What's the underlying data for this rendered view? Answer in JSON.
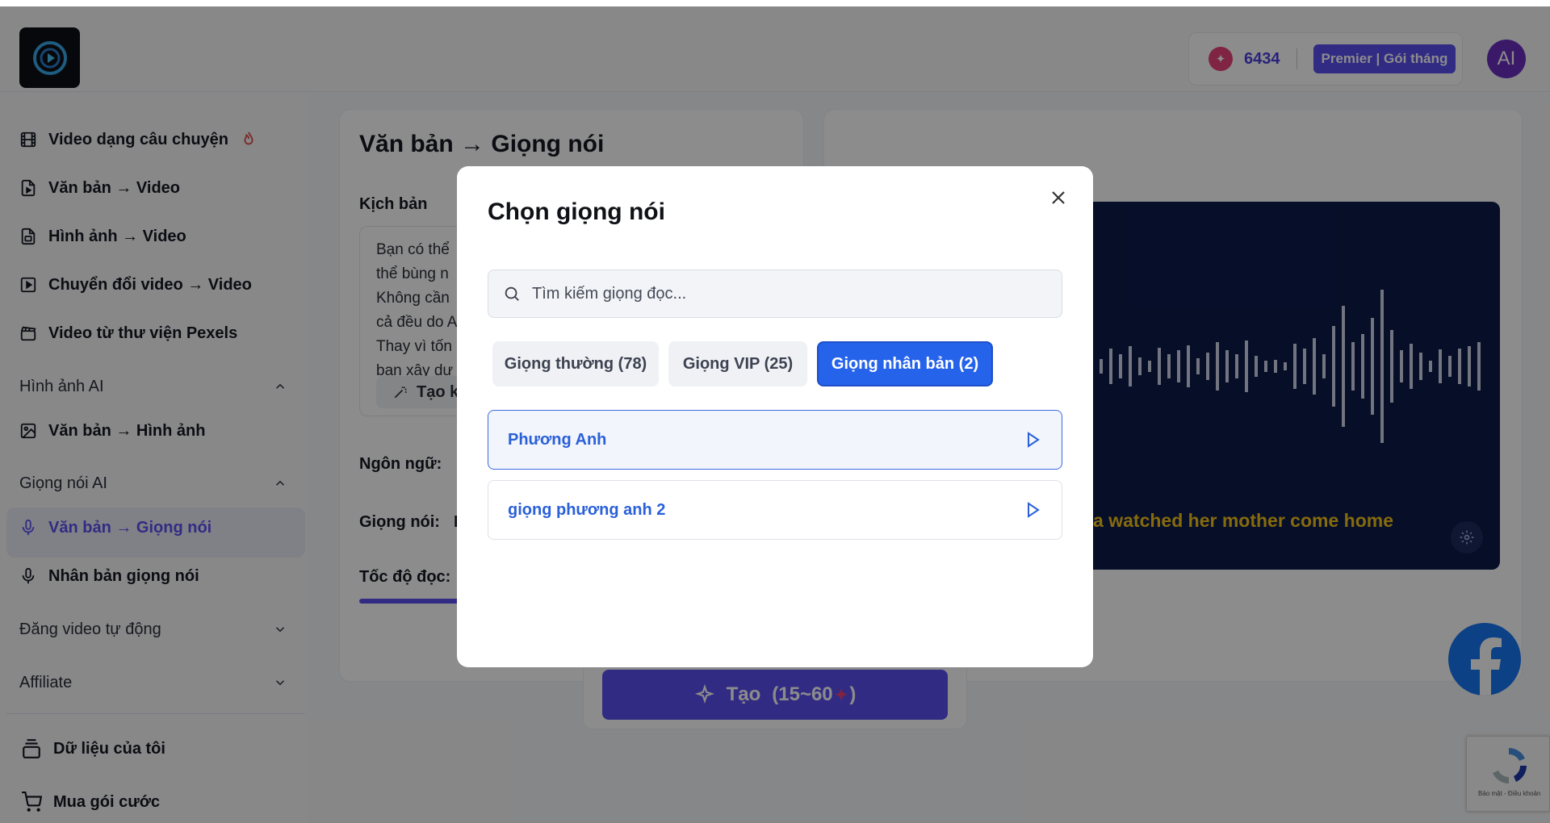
{
  "header": {
    "credits": "6434",
    "plan_badge": "Premier | Gói tháng",
    "avatar_initials": "AI"
  },
  "sidebar": {
    "items": [
      {
        "label": "Video dạng câu chuyện",
        "icon": "film-icon"
      },
      {
        "label": "Văn bản → Video",
        "icon": "file-video-icon"
      },
      {
        "label": "Hình ảnh → Video",
        "icon": "image-video-icon"
      },
      {
        "label": "Chuyển đổi video → Video",
        "icon": "video-convert-icon"
      },
      {
        "label": "Video từ thư viện Pexels",
        "icon": "clapperboard-icon"
      }
    ],
    "section_images": "Hình ảnh AI",
    "image_items": [
      {
        "label": "Văn bản → Hình ảnh",
        "icon": "image-icon"
      }
    ],
    "section_voice": "Giọng nói AI",
    "voice_items": [
      {
        "label": "Văn bản → Giọng nói",
        "icon": "mic-icon",
        "active": true
      },
      {
        "label": "Nhân bản giọng nói",
        "icon": "mic-icon"
      }
    ],
    "section_autopost": "Đăng video tự động",
    "section_affiliate": "Affiliate",
    "bottom_items": [
      {
        "label": "Dữ liệu của tôi",
        "icon": "layers-icon"
      },
      {
        "label": "Mua gói cước",
        "icon": "cart-icon"
      }
    ]
  },
  "main": {
    "title": "Văn bản → Giọng nói",
    "script_label": "Kịch bản",
    "script_text": "Bạn có thể\nthể bùng n\nKhông cần\ncả đều do A\nThay vì tốn\nbạn xây dự",
    "ai_button": "Tạo k",
    "language_label": "Ngôn ngữ:",
    "voice_label": "Giọng nói:",
    "voice_value": "I",
    "speed_label": "Tốc độ đọc:",
    "create_button": "Tạo",
    "create_cost": "(15~60",
    "create_cost_end": ")",
    "preview_subtitle": "na watched her mother come home"
  },
  "recaptcha": {
    "text": "Bảo mật - Điều khoản"
  },
  "modal": {
    "title": "Chọn giọng nói",
    "search_placeholder": "Tìm kiếm giọng đọc...",
    "search_value": "",
    "tabs": [
      {
        "label": "Giọng thường (78)",
        "active": false
      },
      {
        "label": "Giọng VIP (25)",
        "active": false
      },
      {
        "label": "Giọng nhân bản (2)",
        "active": true
      }
    ],
    "voices": [
      {
        "name": "Phương Anh",
        "selected": true
      },
      {
        "name": "giọng phương anh 2",
        "selected": false
      }
    ]
  },
  "colors": {
    "accent": "#5b4ff0",
    "modal_active_tab": "#2563eb",
    "voice_name": "#2a60d8",
    "subtitle": "#f2c21a",
    "facebook": "#1877f2"
  }
}
